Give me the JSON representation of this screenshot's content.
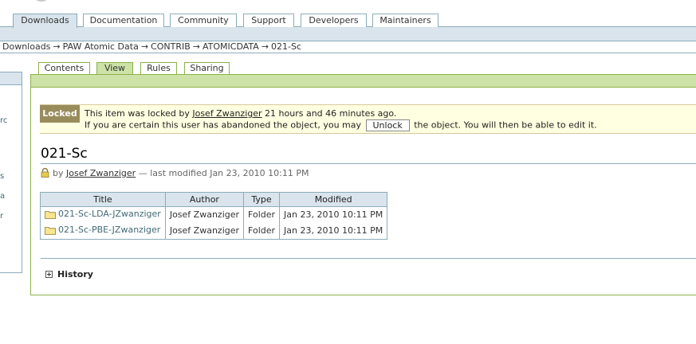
{
  "portal_tabs": [
    {
      "label": "Downloads",
      "selected": true
    },
    {
      "label": "Documentation",
      "selected": false
    },
    {
      "label": "Community",
      "selected": false
    },
    {
      "label": "Support",
      "selected": false
    },
    {
      "label": "Developers",
      "selected": false
    },
    {
      "label": "Maintainers",
      "selected": false
    }
  ],
  "breadcrumb": [
    "Downloads",
    "PAW Atomic Data",
    "CONTRIB",
    "ATOMICDATA",
    "021-Sc"
  ],
  "breadcrumb_separator": "→",
  "left_fragments": [
    "rc",
    "s",
    "a",
    "r"
  ],
  "content_tabs": [
    {
      "label": "Contents",
      "selected": false
    },
    {
      "label": "View",
      "selected": true
    },
    {
      "label": "Rules",
      "selected": false
    },
    {
      "label": "Sharing",
      "selected": false
    }
  ],
  "lock": {
    "label": "Locked",
    "line1_prefix": "This item was locked by",
    "locked_by": "Josef Zwanziger",
    "line1_suffix": "21 hours and 46 minutes ago.",
    "line2_prefix": "If you are certain this user has abandoned the object, you may",
    "unlock_button": "Unlock",
    "line2_suffix": "the object. You will then be able to edit it."
  },
  "document": {
    "title": "021-Sc",
    "by_prefix": "by",
    "author": "Josef Zwanziger",
    "modified_text": "— last modified Jan 23, 2010 10:11 PM"
  },
  "table": {
    "headers": [
      "Title",
      "Author",
      "Type",
      "Modified"
    ],
    "rows": [
      {
        "title": "021-Sc-LDA-JZwanziger",
        "author": "Josef Zwanziger",
        "type": "Folder",
        "modified": "Jan 23, 2010 10:11 PM"
      },
      {
        "title": "021-Sc-PBE-JZwanziger",
        "author": "Josef Zwanziger",
        "type": "Folder",
        "modified": "Jan 23, 2010 10:11 PM"
      }
    ]
  },
  "history_label": "History",
  "colors": {
    "blue_border": "#8cacbb",
    "blue_fill": "#d9e4ec",
    "green_border": "#8cb14a",
    "green_fill": "#cde2a7",
    "lock_label_bg": "#998c5c",
    "lock_box_bg": "#ffffe1"
  },
  "icons": [
    "lock-icon",
    "folder-icon",
    "expand-plus-icon"
  ]
}
